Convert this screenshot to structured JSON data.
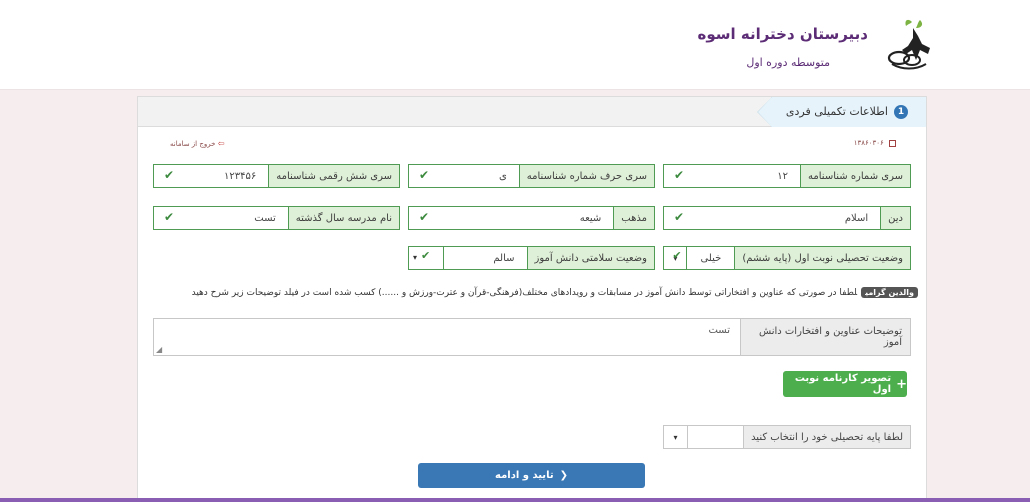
{
  "header": {
    "school_name": "دبیرستان دخترانه اسوه",
    "school_sub": "متوسطه دوره اول"
  },
  "colors": {
    "brand": "#5c2d76",
    "success": "#4cae4c",
    "primary": "#3a78b5",
    "field_border": "#4f9b53"
  },
  "panel": {
    "step_number": "1",
    "step_label": "اطلاعات تکمیلی فردی",
    "code": "۱۳۸۶۰۳۰۶",
    "logout": "خروج از سامانه"
  },
  "fields": {
    "id_series_num": {
      "label": "سری شماره شناسنامه",
      "value": "۱۲"
    },
    "id_series_letter": {
      "label": "سری حرف شماره شناسنامه",
      "value": "ی"
    },
    "id_serial_six": {
      "label": "سری شش رقمی شناسنامه",
      "value": "۱۲۳۴۵۶"
    },
    "religion": {
      "label": "دین",
      "value": "اسلام"
    },
    "sect": {
      "label": "مذهب",
      "value": "شیعه"
    },
    "prev_school": {
      "label": "نام مدرسه سال گذشته",
      "value": "تست"
    },
    "first_term_status": {
      "label": "وضعیت تحصیلی نوبت اول (پایه ششم)",
      "value": "خیلی"
    },
    "health_status": {
      "label": "وضعیت سلامتی دانش آموز",
      "value": "سالم"
    }
  },
  "notice": {
    "tag": "والدین گرامی",
    "text": "لطفا در صورتی که عناوین و افتخاراتی توسط دانش آموز در مسابقات و رویدادهای مختلف(فرهنگی-قرآن و عترت-ورزش و ......) کسب شده است در فیلد توضیحات زیر شرح دهید"
  },
  "achievements": {
    "label": "توضیحات عناوین و افتخارات دانش آموز",
    "value": "تست"
  },
  "upload_button": "تصویر کارنامه نوبت اول",
  "grade_select": {
    "label": "لطفا پایه تحصیلی خود را انتخاب کنید"
  },
  "submit_button": "تایید و ادامه"
}
